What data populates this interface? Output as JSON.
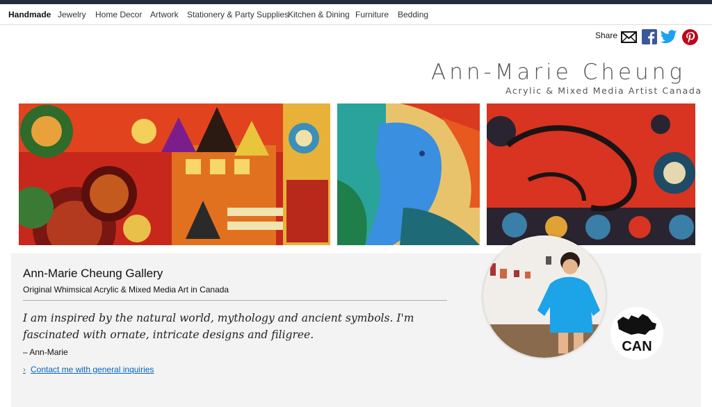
{
  "nav": {
    "items": [
      "Handmade",
      "Jewelry",
      "Home Decor",
      "Artwork",
      "Stationery & Party Supplies",
      "Kitchen & Dining",
      "Furniture",
      "Bedding"
    ]
  },
  "share": {
    "label": "Share",
    "icons": [
      "email-icon",
      "facebook-icon",
      "twitter-icon",
      "pinterest-icon"
    ]
  },
  "brand": {
    "title": "Ann-Marie Cheung",
    "subtitle": "Acrylic & Mixed Media Artist Canada"
  },
  "profile": {
    "name": "Ann-Marie Cheung Gallery",
    "tagline": "Original Whimsical Acrylic & Mixed Media Art in Canada",
    "quote": "I am inspired by the natural world, mythology and ancient symbols. I'm fascinated with ornate, intricate designs and filigree.",
    "signature": "– Ann-Marie",
    "contact_link": "Contact me with general inquiries",
    "country_badge": "CAN"
  },
  "colors": {
    "topbar": "#232f3e",
    "link": "#0066c0",
    "facebook": "#3b5998",
    "twitter": "#1da1f2",
    "pinterest": "#bd081c"
  }
}
